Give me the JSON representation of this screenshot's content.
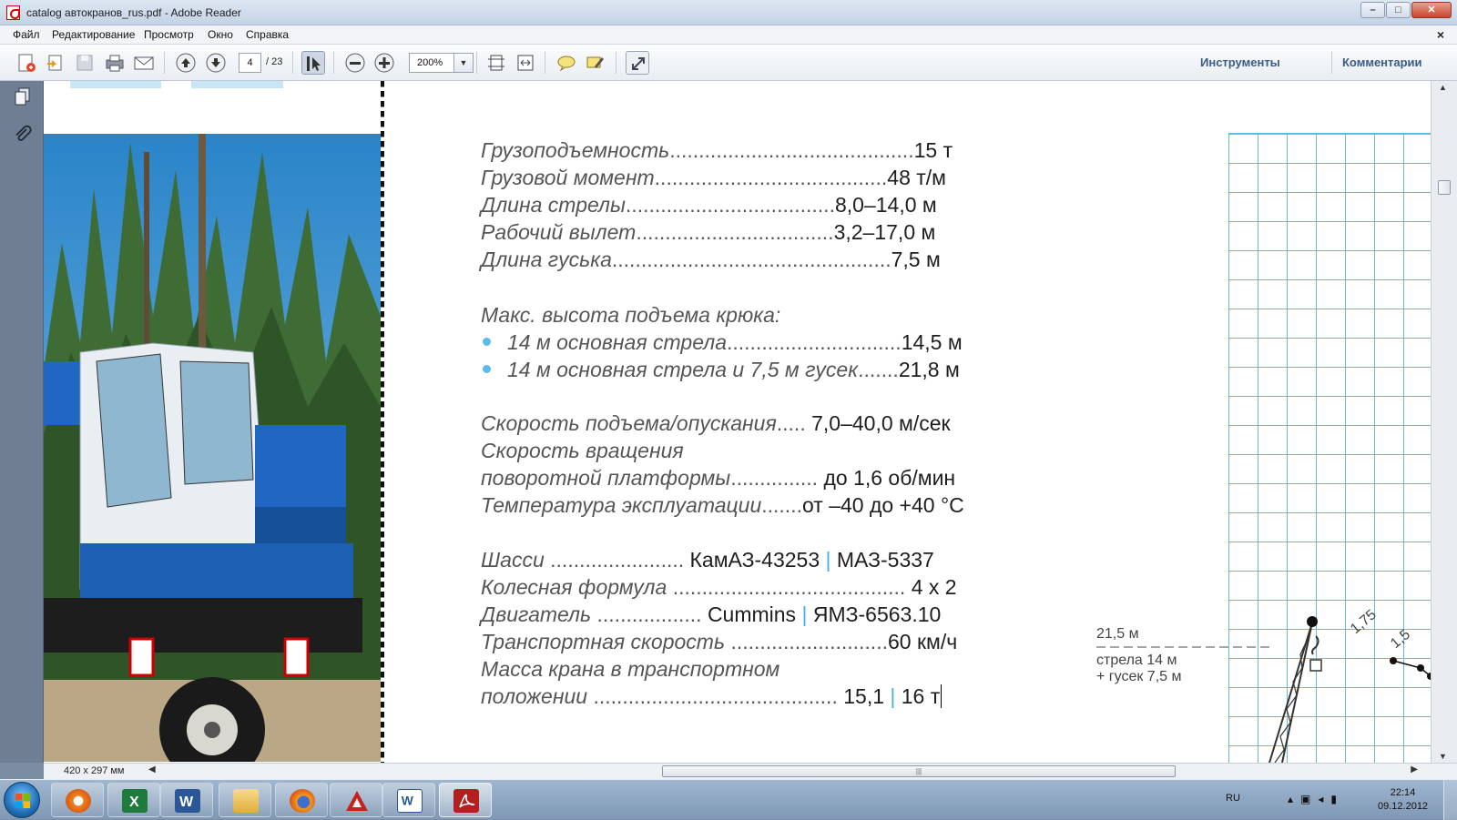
{
  "window": {
    "title": "catalog автокранов_rus.pdf - Adobe Reader"
  },
  "menu": {
    "items": [
      "Файл",
      "Редактирование",
      "Просмотр",
      "Окно",
      "Справка"
    ],
    "close_glyph": "×"
  },
  "toolbar": {
    "page_current": "4",
    "page_total": "/ 23",
    "zoom": "200%",
    "tools_label": "Инструменты",
    "comments_label": "Комментарии",
    "icons": [
      "create-pdf-icon",
      "open-icon",
      "save-icon",
      "print-icon",
      "email-icon",
      "prev-page-icon",
      "next-page-icon",
      "select-tool-icon",
      "zoom-out-icon",
      "zoom-in-icon",
      "fit-page-icon",
      "fit-width-icon",
      "comment-icon",
      "highlight-icon",
      "fullscreen-icon"
    ]
  },
  "document": {
    "specs": [
      {
        "label": "Грузоподъемность",
        "dots": "..........................................",
        "value": "15 т"
      },
      {
        "label": "Грузовой момент",
        "dots": "........................................",
        "value": "48 т/м"
      },
      {
        "label": "Длина стрелы",
        "dots": "....................................",
        "value": "8,0–14,0 м"
      },
      {
        "label": "Рабочий вылет",
        "dots": "..................................",
        "value": "3,2–17,0 м"
      },
      {
        "label": "Длина гуська",
        "dots": "................................................",
        "value": "7,5 м"
      }
    ],
    "hook_heading": "Макс. высота подъема крюка:",
    "hook_items": [
      {
        "label": "14 м основная стрела",
        "dots": "..............................",
        "value": "14,5 м"
      },
      {
        "label": "14 м основная стрела и 7,5 м гусек",
        "dots": ".......",
        "value": "21,8 м"
      }
    ],
    "speed": {
      "lift_label": "Скорость подъема/опускания",
      "lift_dots": ".....",
      "lift_value": "7,0–40,0 м/сек",
      "rot_label_1": "Скорость вращения",
      "rot_label_2": "поворотной платформы",
      "rot_dots": "...............",
      "rot_value": "до 1,6 об/мин",
      "temp_label": "Температура эксплуатации",
      "temp_dots": ".......",
      "temp_value": "от –40 до +40 °С"
    },
    "chassis": {
      "chassis_label": "Шасси",
      "chassis_dots": ".......................",
      "chassis_value_a": "КамАЗ-43253",
      "chassis_value_b": "МАЗ-5337",
      "wheel_label": "Колесная формула",
      "wheel_dots": "........................................",
      "wheel_value": "4 x 2",
      "engine_label": "Двигатель",
      "engine_dots": "..................",
      "engine_value_a": "Cummins",
      "engine_value_b": "ЯМЗ-6563.10",
      "speed_label": "Транспортная скорость",
      "speed_dots": "...........................",
      "speed_value": "60 км/ч",
      "mass_label_1": "Масса крана в транспортном",
      "mass_label_2": "положении",
      "mass_dots": "..........................................",
      "mass_value_a": "15,1",
      "mass_value_b": "16 т"
    },
    "diagram": {
      "height_label": "21,5 м",
      "caption_1": "стрела 14 м",
      "caption_2": "+ гусек 7,5 м",
      "tick_a": "1,75",
      "tick_b": "1,5"
    }
  },
  "statusbar": {
    "page_size": "420 x 297 мм"
  },
  "taskbar": {
    "apps": [
      "media-player-icon",
      "excel-icon",
      "word-icon",
      "explorer-icon",
      "firefox-icon",
      "autocad-icon",
      "word-doc-icon",
      "acrobat-icon"
    ],
    "lang": "RU",
    "time": "22:14",
    "date": "09.12.2012"
  },
  "colors": {
    "accent_blue": "#4ab2e3",
    "grid_blue": "#5fbce9",
    "link_blue": "#3a5c86"
  }
}
